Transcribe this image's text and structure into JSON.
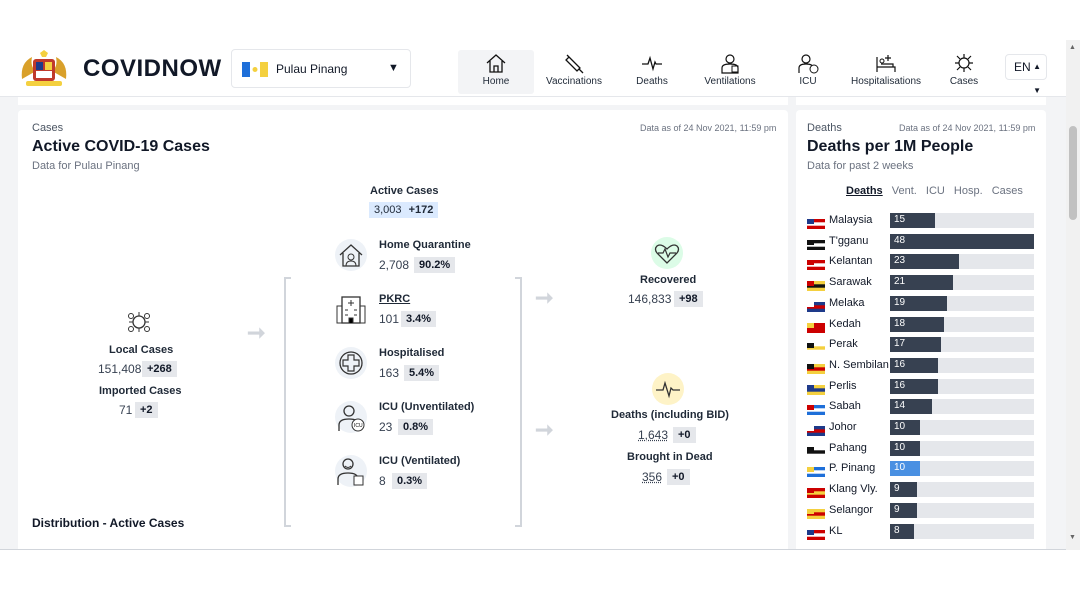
{
  "header": {
    "brand": "COVIDNOW",
    "state": "Pulau Pinang",
    "lang": "EN",
    "nav": [
      {
        "label": "Home",
        "icon": "home-icon",
        "active": true
      },
      {
        "label": "Vaccinations",
        "icon": "syringe-icon"
      },
      {
        "label": "Deaths",
        "icon": "pulse-icon"
      },
      {
        "label": "Ventilations",
        "icon": "ventilator-icon"
      },
      {
        "label": "ICU",
        "icon": "icu-icon"
      },
      {
        "label": "Hospitalisations",
        "icon": "hospital-bed-icon"
      },
      {
        "label": "Cases",
        "icon": "virus-icon"
      }
    ]
  },
  "cases_card": {
    "tag": "Cases",
    "title": "Active COVID-19 Cases",
    "subtitle": "Data for Pulau Pinang",
    "as_of": "Data as of 24 Nov 2021, 11:59 pm",
    "active": {
      "label": "Active Cases",
      "value": "3,003",
      "delta": "+172"
    },
    "local": {
      "label": "Local Cases",
      "value": "151,408",
      "delta": "+268"
    },
    "imported": {
      "label": "Imported Cases",
      "value": "71",
      "delta": "+2"
    },
    "breakdown": [
      {
        "label": "Home Quarantine",
        "value": "2,708",
        "pct": "90.2%",
        "icon": "house-icon"
      },
      {
        "label": "PKRC",
        "value": "101",
        "pct": "3.4%",
        "icon": "building-icon"
      },
      {
        "label": "Hospitalised",
        "value": "163",
        "pct": "5.4%",
        "icon": "medical-cross-icon"
      },
      {
        "label": "ICU (Unventilated)",
        "value": "23",
        "pct": "0.8%",
        "icon": "icu-patient-icon"
      },
      {
        "label": "ICU (Ventilated)",
        "value": "8",
        "pct": "0.3%",
        "icon": "ventilated-patient-icon"
      }
    ],
    "recovered": {
      "label": "Recovered",
      "value": "146,833",
      "delta": "+98"
    },
    "deaths": {
      "label": "Deaths (including BID)",
      "value": "1,643",
      "delta": "+0"
    },
    "bid": {
      "label": "Brought in Dead",
      "value": "356",
      "delta": "+0"
    },
    "distribution_title": "Distribution - Active Cases",
    "distribution_colors": [
      "#6ee7b7",
      "#fde68a",
      "#f59e0b",
      "#ef4444"
    ]
  },
  "deaths_card": {
    "tag": "Deaths",
    "as_of": "Data as of 24 Nov 2021, 11:59 pm",
    "title": "Deaths per 1M People",
    "subtitle": "Data for past 2 weeks",
    "tabs": [
      "Deaths",
      "Vent.",
      "ICU",
      "Hosp.",
      "Cases"
    ],
    "active_tab": "Deaths"
  },
  "chart_data": {
    "type": "bar",
    "title": "Deaths per 1M People",
    "categories": [
      "Malaysia",
      "T'gganu",
      "Kelantan",
      "Sarawak",
      "Melaka",
      "Kedah",
      "Perak",
      "N. Sembilan",
      "Perlis",
      "Sabah",
      "Johor",
      "Pahang",
      "P. Pinang",
      "Klang Vly.",
      "Selangor",
      "KL"
    ],
    "values": [
      15,
      48,
      23,
      21,
      19,
      18,
      17,
      16,
      16,
      14,
      10,
      10,
      10,
      9,
      9,
      8
    ],
    "highlight": "P. Pinang",
    "colors": {
      "bar": "#374151",
      "highlight": "#4a90e2",
      "track": "#e5e7eb"
    },
    "xlim": [
      0,
      48
    ]
  }
}
